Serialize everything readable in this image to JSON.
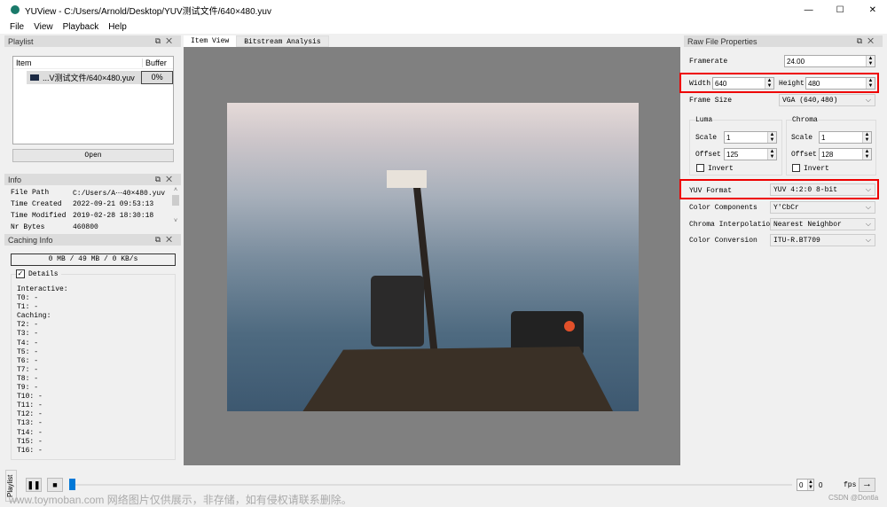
{
  "window": {
    "title": "YUView - C:/Users/Arnold/Desktop/YUV测试文件/640×480.yuv",
    "minimize": "—",
    "maximize": "☐",
    "close": "✕"
  },
  "menu": [
    "File",
    "View",
    "Playback",
    "Help"
  ],
  "playlist": {
    "title": "Playlist",
    "col_item": "Item",
    "col_buffer": "Buffer",
    "item_name": "...V测试文件/640×480.yuv",
    "item_buffer": "0%",
    "open": "Open"
  },
  "info": {
    "title": "Info",
    "rows": [
      {
        "k": "File Path",
        "v": "C:/Users/A⋯40×480.yuv"
      },
      {
        "k": "Time Created",
        "v": "2022-09-21 09:53:13"
      },
      {
        "k": "Time Modified",
        "v": "2019-02-28 18:30:18"
      },
      {
        "k": "Nr Bytes",
        "v": "460800"
      }
    ]
  },
  "caching": {
    "title": "Caching Info",
    "status": "0 MB / 49 MB / 0 KB/s",
    "details_label": "Details",
    "lines": [
      "Interactive:",
      "T0: -",
      "T1: -",
      "Caching:",
      "T2: -",
      "T3: -",
      "T4: -",
      "T5: -",
      "T6: -",
      "T7: -",
      "T8: -",
      "T9: -",
      "T10: -",
      "T11: -",
      "T12: -",
      "T13: -",
      "T14: -",
      "T15: -",
      "T16: -"
    ]
  },
  "tabs": [
    "Item View",
    "Bitstream Analysis"
  ],
  "raw": {
    "title": "Raw File Properties",
    "framerate_label": "Framerate",
    "framerate": "24.00",
    "width_label": "Width",
    "width": "640",
    "height_label": "Height",
    "height": "480",
    "frame_size_label": "Frame Size",
    "frame_size": "VGA (640,480)",
    "luma": {
      "title": "Luma",
      "scale_label": "Scale",
      "scale": "1",
      "offset_label": "Offset",
      "offset": "125",
      "invert": "Invert"
    },
    "chroma": {
      "title": "Chroma",
      "scale_label": "Scale",
      "scale": "1",
      "offset_label": "Offset",
      "offset": "128",
      "invert": "Invert"
    },
    "yuv_format_label": "YUV Format",
    "yuv_format": "YUV 4:2:0 8-bit",
    "components_label": "Color Components",
    "components": "Y'CbCr",
    "interp_label": "Chroma Interpolation",
    "interp": "Nearest Neighbor",
    "conversion_label": "Color Conversion",
    "conversion": "ITU-R.BT709"
  },
  "playback": {
    "frame": "0",
    "max": "0",
    "fps_label": "fps",
    "side_tab": "Playlist",
    "progress": 0
  },
  "watermark": "www.toymoban.com 网络图片仅供展示，非存储，如有侵权请联系删除。",
  "credit": "CSDN @Dontla",
  "colors": {
    "highlight": "#e00000",
    "accent": "#0078d7"
  }
}
